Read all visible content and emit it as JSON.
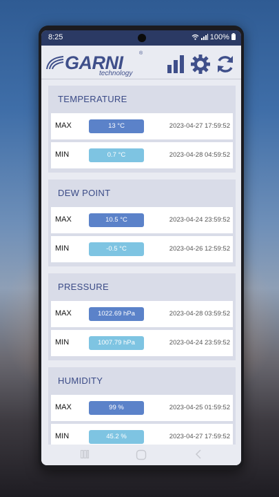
{
  "status_bar": {
    "time": "8:25",
    "battery": "100%"
  },
  "header": {
    "logo_text": "GARNI",
    "logo_sub": "technology",
    "logo_reg": "®",
    "icons": [
      "bar-chart-icon",
      "gear-icon",
      "refresh-icon"
    ]
  },
  "colors": {
    "accent": "#3a4a86",
    "max_pill": "#5b82c9",
    "min_pill": "#7ec4e2",
    "status_bar": "#2b3a64"
  },
  "sections": [
    {
      "title": "TEMPERATURE",
      "max": {
        "label": "MAX",
        "value": "13 °C",
        "time": "2023-04-27 17:59:52"
      },
      "min": {
        "label": "MIN",
        "value": "0.7 °C",
        "time": "2023-04-28 04:59:52"
      }
    },
    {
      "title": "DEW POINT",
      "max": {
        "label": "MAX",
        "value": "10.5 °C",
        "time": "2023-04-24 23:59:52"
      },
      "min": {
        "label": "MIN",
        "value": "-0.5 °C",
        "time": "2023-04-26 12:59:52"
      }
    },
    {
      "title": "PRESSURE",
      "max": {
        "label": "MAX",
        "value": "1022.69 hPa",
        "time": "2023-04-28 03:59:52"
      },
      "min": {
        "label": "MIN",
        "value": "1007.79 hPa",
        "time": "2023-04-24 23:59:52"
      }
    },
    {
      "title": "HUMIDITY",
      "max": {
        "label": "MAX",
        "value": "99 %",
        "time": "2023-04-25 01:59:52"
      },
      "min": {
        "label": "MIN",
        "value": "45.2 %",
        "time": "2023-04-27 17:59:52"
      }
    }
  ]
}
